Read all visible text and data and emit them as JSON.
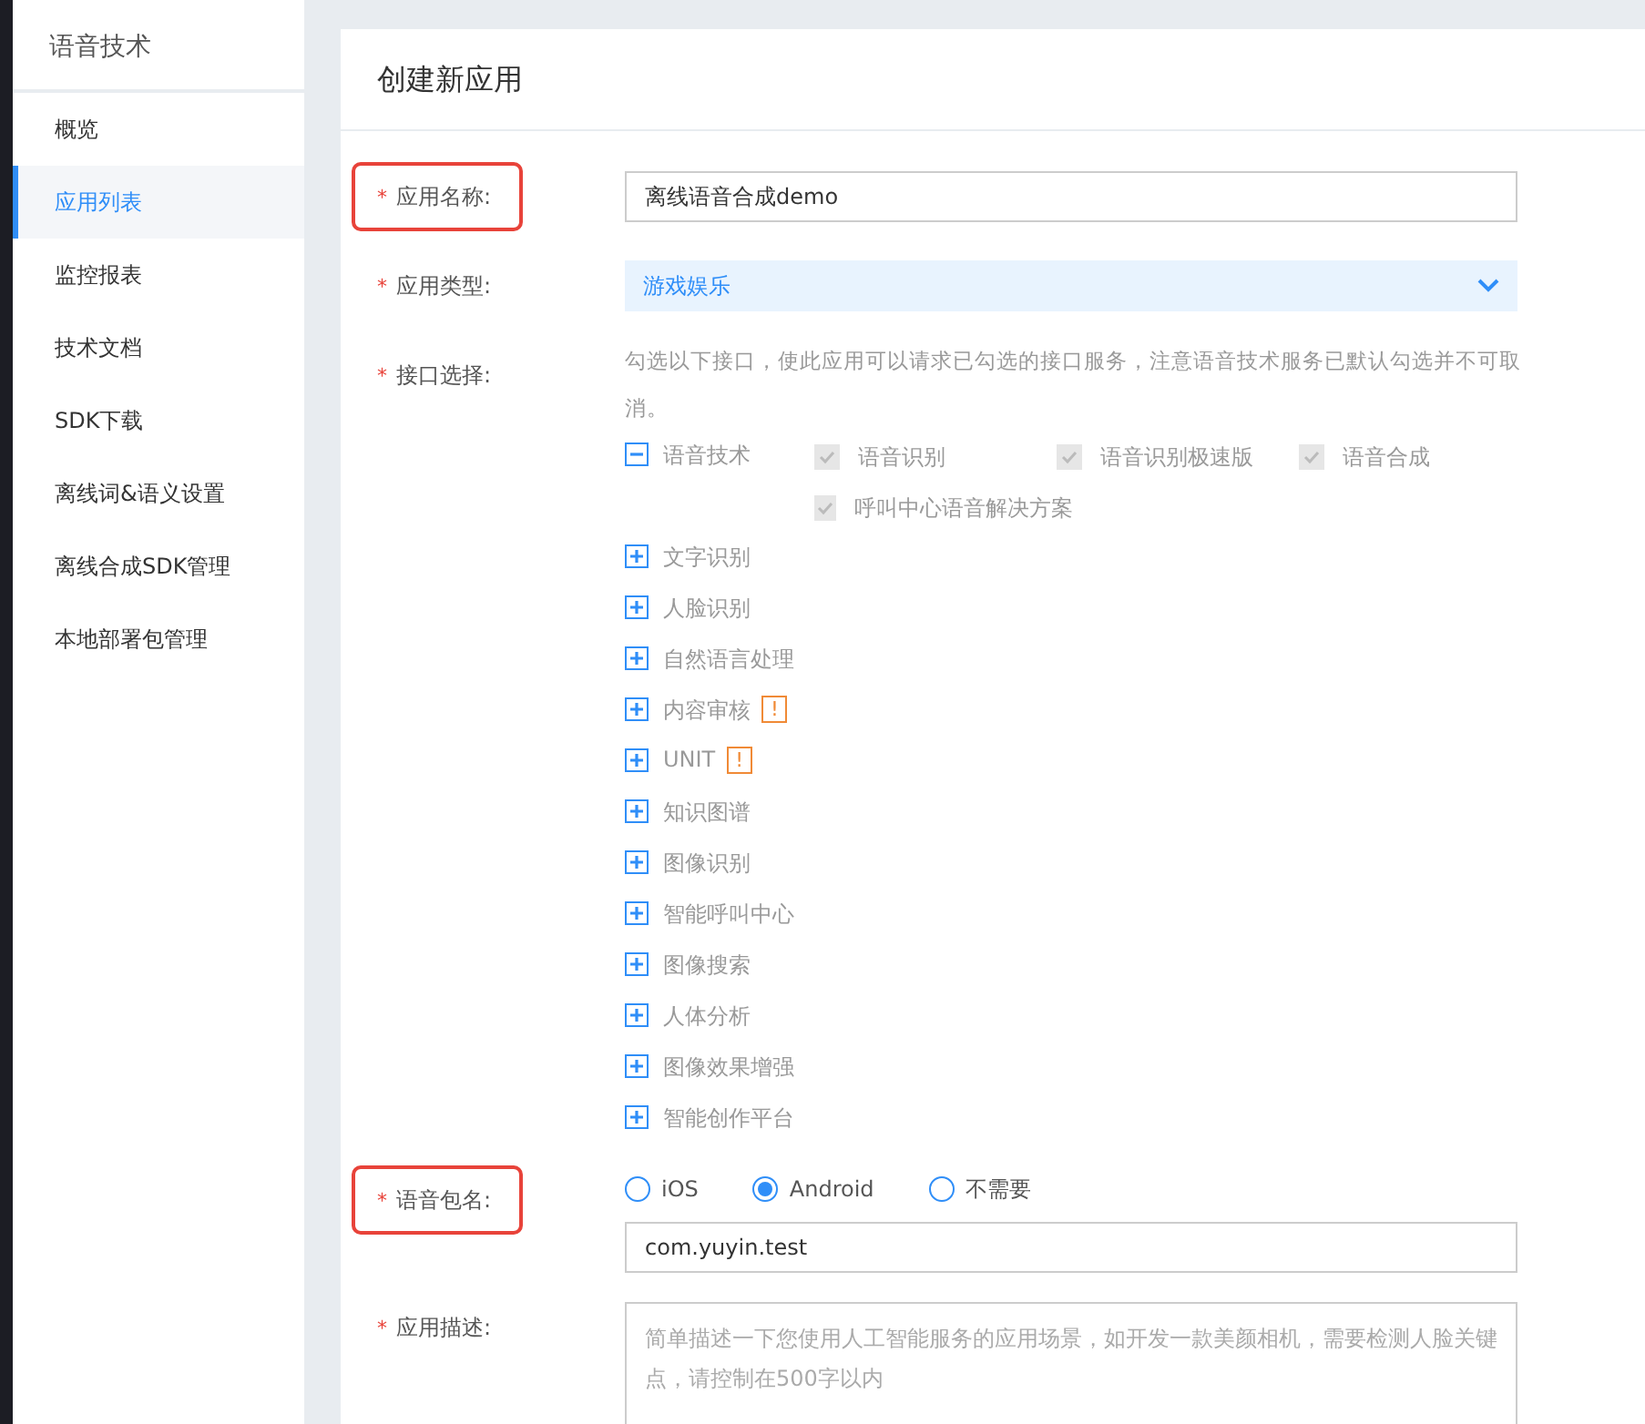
{
  "sidebar": {
    "title": "语音技术",
    "items": [
      {
        "label": "概览",
        "selected": false
      },
      {
        "label": "应用列表",
        "selected": true
      },
      {
        "label": "监控报表",
        "selected": false
      },
      {
        "label": "技术文档",
        "selected": false
      },
      {
        "label": "SDK下载",
        "selected": false
      },
      {
        "label": "离线词&语义设置",
        "selected": false
      },
      {
        "label": "离线合成SDK管理",
        "selected": false
      },
      {
        "label": "本地部署包管理",
        "selected": false
      }
    ]
  },
  "card": {
    "title": "创建新应用",
    "fields": [
      {
        "kind": "input",
        "label": "应用名称:",
        "required_mark": "*",
        "highlighted": true,
        "value": "离线语音合成demo"
      },
      {
        "kind": "select",
        "label": "应用类型:",
        "required_mark": "*",
        "highlighted": false,
        "value": "游戏娱乐"
      },
      {
        "kind": "apis",
        "label": "接口选择:",
        "required_mark": "*",
        "highlighted": false,
        "hint": "勾选以下接口，使此应用可以请求已勾选的接口服务，注意语音技术服务已默认勾选并不可取消。",
        "groups": [
          {
            "label": "语音技术",
            "expanded": true,
            "children": [
              {
                "label": "语音识别",
                "checked": true,
                "disabled": true
              },
              {
                "label": "语音识别极速版",
                "checked": true,
                "disabled": true
              },
              {
                "label": "语音合成",
                "checked": true,
                "disabled": true
              },
              {
                "label": "呼叫中心语音解决方案",
                "checked": true,
                "disabled": true
              }
            ]
          },
          {
            "label": "文字识别",
            "expanded": false
          },
          {
            "label": "人脸识别",
            "expanded": false
          },
          {
            "label": "自然语言处理",
            "expanded": false
          },
          {
            "label": "内容审核",
            "expanded": false,
            "badge": "!"
          },
          {
            "label": "UNIT",
            "expanded": false,
            "badge": "!"
          },
          {
            "label": "知识图谱",
            "expanded": false
          },
          {
            "label": "图像识别",
            "expanded": false
          },
          {
            "label": "智能呼叫中心",
            "expanded": false
          },
          {
            "label": "图像搜索",
            "expanded": false
          },
          {
            "label": "人体分析",
            "expanded": false
          },
          {
            "label": "图像效果增强",
            "expanded": false
          },
          {
            "label": "智能创作平台",
            "expanded": false
          }
        ]
      },
      {
        "kind": "package",
        "label": "语音包名:",
        "required_mark": "*",
        "highlighted": true,
        "options": [
          {
            "label": "iOS",
            "selected": false
          },
          {
            "label": "Android",
            "selected": true
          },
          {
            "label": "不需要",
            "selected": false
          }
        ],
        "value": "com.yuyin.test"
      },
      {
        "kind": "textarea",
        "label": "应用描述:",
        "required_mark": "*",
        "highlighted": false,
        "placeholder": "简单描述一下您使用人工智能服务的应用场景，如开发一款美颜相机，需要检测人脸关键点，请控制在500字以内"
      }
    ]
  }
}
